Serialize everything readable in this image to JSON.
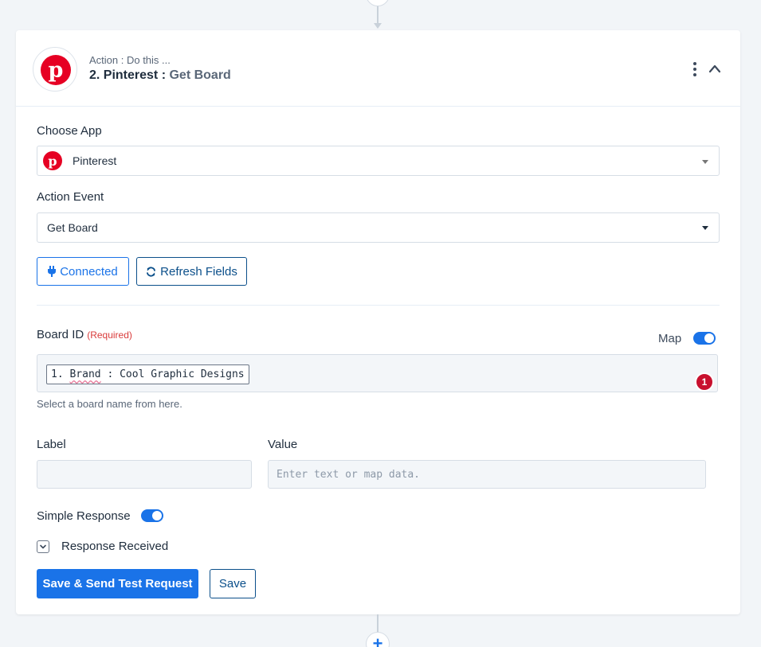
{
  "step": {
    "subtitle": "Action : Do this ...",
    "title_prefix": "2. Pinterest : ",
    "title_event": "Get Board",
    "app_logo": "pinterest-logo",
    "logo_letter": "p"
  },
  "form": {
    "choose_app_label": "Choose App",
    "choose_app_value": "Pinterest",
    "action_event_label": "Action Event",
    "action_event_value": "Get Board",
    "connected_button": "Connected",
    "refresh_button": "Refresh Fields",
    "board_id_label": "Board ID",
    "required_tag": "(Required)",
    "map_label": "Map",
    "map_enabled": true,
    "board_id_chip_prefix": "1. ",
    "board_id_chip_link": "Brand",
    "board_id_chip_rest": " : Cool Graphic Designs",
    "board_id_badge": "1",
    "board_id_hint": "Select a board name from here.",
    "label_label": "Label",
    "label_value": "",
    "value_label": "Value",
    "value_placeholder": "Enter text or map data.",
    "simple_response_label": "Simple Response",
    "simple_response_enabled": true,
    "response_received_label": "Response Received",
    "save_send_button": "Save & Send Test Request",
    "save_button": "Save"
  },
  "flow": {
    "add_step_symbol": "+"
  },
  "colors": {
    "accent": "#1a73e8",
    "pinterest": "#e60023",
    "required": "#d93b3b",
    "badge": "#c8102e"
  }
}
